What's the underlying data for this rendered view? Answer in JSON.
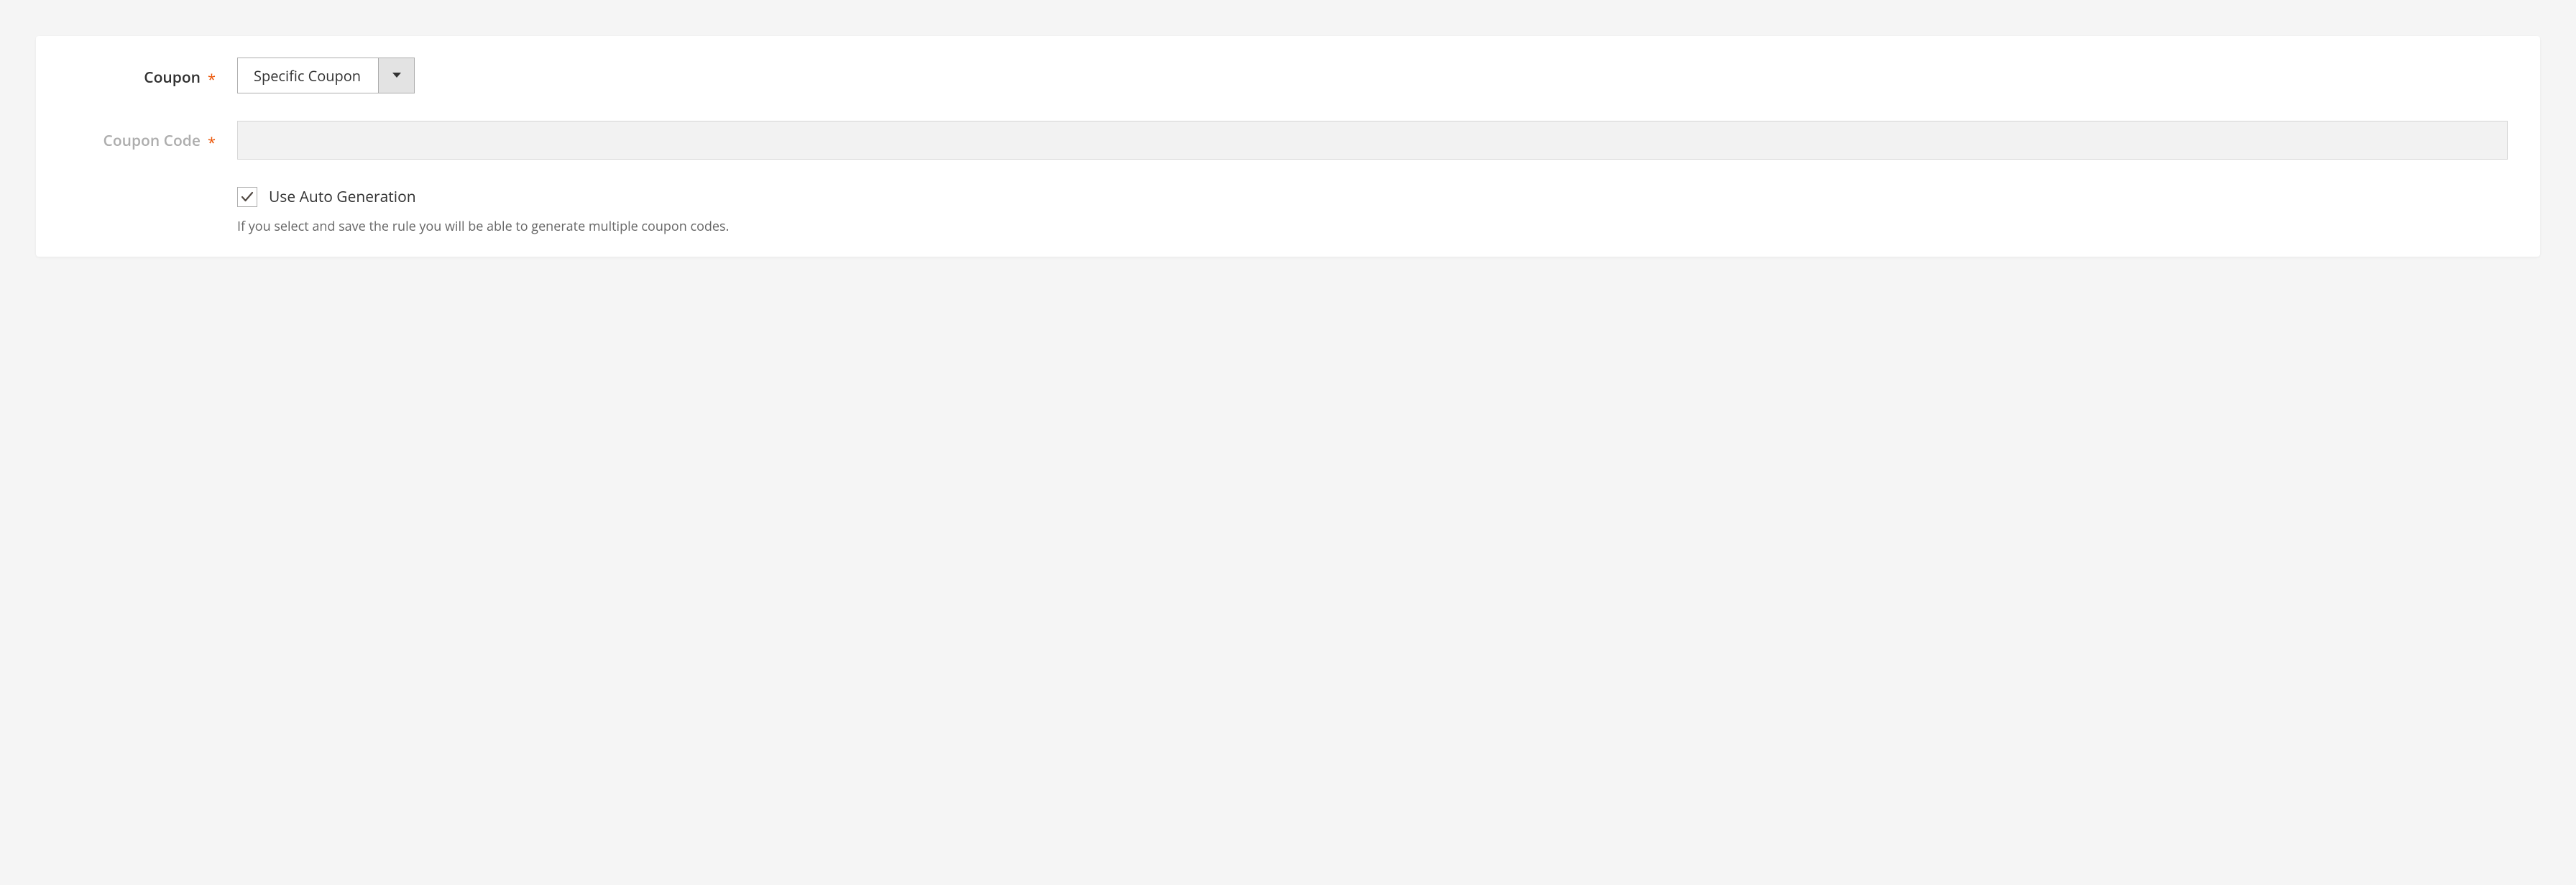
{
  "coupon": {
    "label": "Coupon",
    "required_marker": "*",
    "selected": "Specific Coupon"
  },
  "coupon_code": {
    "label": "Coupon Code",
    "required_marker": "*",
    "value": ""
  },
  "auto_gen": {
    "label": "Use Auto Generation",
    "checked": true,
    "note": "If you select and save the rule you will be able to generate multiple coupon codes."
  }
}
